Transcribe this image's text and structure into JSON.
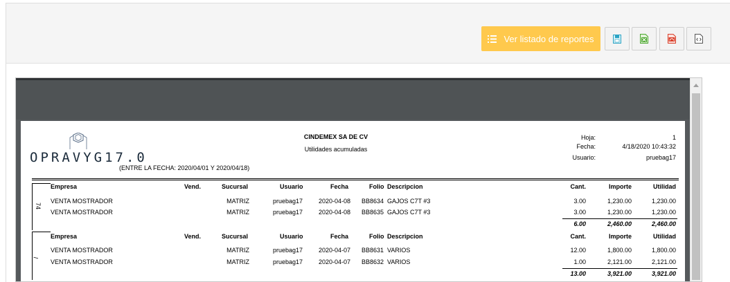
{
  "toolbar": {
    "reports_button_label": "Ver listado de reportes",
    "icons": [
      "save-icon",
      "excel-icon",
      "pdf-icon",
      "code-icon"
    ]
  },
  "report": {
    "logo_text": "OPRAVYG17.0",
    "company": "CINDEMEX SA DE CV",
    "subtitle": "Utilidades acumuladas",
    "date_range": "(ENTRE LA FECHA: 2020/04/01 Y 2020/04/18)",
    "meta": {
      "hoja_label": "Hoja:",
      "hoja_value": "1",
      "fecha_label": "Fecha:",
      "fecha_value": "4/18/2020  10:43:32",
      "usuario_label": "Usuario:",
      "usuario_value": "pruebag17"
    },
    "columns": {
      "empresa": "Empresa",
      "vend": "Vend.",
      "sucursal": "Sucursal",
      "usuario": "Usuario",
      "fecha": "Fecha",
      "folio": "Folio",
      "descripcion": "Descripcion",
      "cant": "Cant.",
      "importe": "Importe",
      "utilidad": "Utilidad"
    },
    "groups": [
      {
        "id": "74",
        "rows": [
          {
            "empresa": "VENTA MOSTRADOR",
            "sucursal": "MATRIZ",
            "usuario": "pruebag17",
            "fecha": "2020-04-08",
            "folio": "BB8634",
            "descripcion": "GAJOS C7T #3",
            "cant": "3.00",
            "importe": "1,230.00",
            "utilidad": "1,230.00"
          },
          {
            "empresa": "VENTA MOSTRADOR",
            "sucursal": "MATRIZ",
            "usuario": "pruebag17",
            "fecha": "2020-04-08",
            "folio": "BB8635",
            "descripcion": "GAJOS C7T #3",
            "cant": "3.00",
            "importe": "1,230.00",
            "utilidad": "1,230.00"
          }
        ],
        "totals": {
          "cant": "6.00",
          "importe": "2,460.00",
          "utilidad": "2,460.00"
        }
      },
      {
        "id": "/",
        "rows": [
          {
            "empresa": "VENTA MOSTRADOR",
            "sucursal": "MATRIZ",
            "usuario": "pruebag17",
            "fecha": "2020-04-07",
            "folio": "BB8631",
            "descripcion": "VARIOS",
            "cant": "12.00",
            "importe": "1,800.00",
            "utilidad": "1,800.00"
          },
          {
            "empresa": "VENTA MOSTRADOR",
            "sucursal": "MATRIZ",
            "usuario": "pruebag17",
            "fecha": "2020-04-07",
            "folio": "BB8632",
            "descripcion": "VARIOS",
            "cant": "1.00",
            "importe": "2,121.00",
            "utilidad": "2,121.00"
          }
        ],
        "totals": {
          "cant": "13.00",
          "importe": "3,921.00",
          "utilidad": "3,921.00"
        }
      }
    ]
  }
}
